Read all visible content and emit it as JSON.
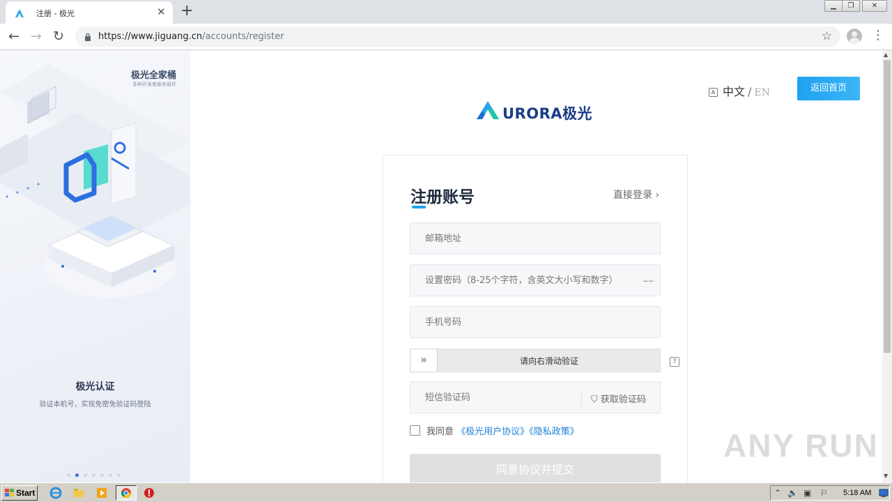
{
  "browser": {
    "tab_title": "注册 - 极光",
    "url_host": "https://www.jiguang.cn",
    "url_path": "/accounts/register"
  },
  "left_panel": {
    "top_title": "极光全家桶",
    "top_subtitle": "多种开发者服务组件",
    "feature_title": "极光认证",
    "feature_desc": "验证本机号，实现免密免验证码登陆",
    "active_slide": 2,
    "slide_count": 7
  },
  "header": {
    "lang_cn": "中文",
    "lang_sep": "/",
    "lang_en": "EN",
    "home_button": "返回首页",
    "logo_text": "URORA极光"
  },
  "form": {
    "title": "注册账号",
    "login_link": "直接登录",
    "email_placeholder": "邮箱地址",
    "password_placeholder": "设置密码（8-25个字符，含英文大小写和数字）",
    "phone_placeholder": "手机号码",
    "slider_text": "请向右滑动验证",
    "help": "?",
    "sms_placeholder": "短信验证码",
    "sms_button": "获取验证码",
    "agree_prefix": "我同意",
    "user_agreement": "《极光用户协议》",
    "privacy_policy": "《隐私政策》",
    "submit": "同意协议并提交"
  },
  "watermark": "ANY RUN",
  "taskbar": {
    "start": "Start",
    "clock": "5:18 AM"
  },
  "colors": {
    "accent": "#1fa1f2",
    "link": "#1e7fd9",
    "logo": "#1b3d86"
  }
}
